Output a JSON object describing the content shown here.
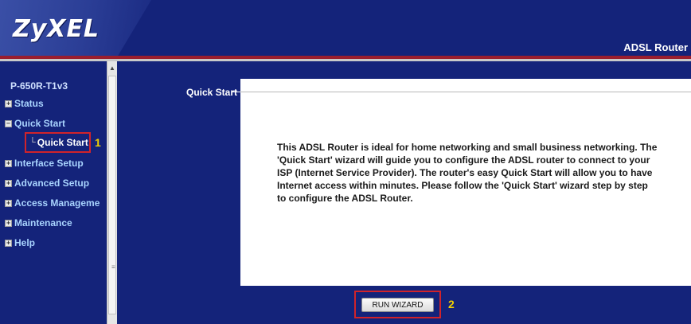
{
  "header": {
    "logo": "ZyXEL",
    "product": "ADSL Router"
  },
  "sidebar": {
    "device": "P-650R-T1v3",
    "items": [
      {
        "label": "Status",
        "expanded": false
      },
      {
        "label": "Quick Start",
        "expanded": true
      },
      {
        "label": "Interface Setup",
        "expanded": false
      },
      {
        "label": "Advanced Setup",
        "expanded": false
      },
      {
        "label": "Access Manageme",
        "expanded": false
      },
      {
        "label": "Maintenance",
        "expanded": false
      },
      {
        "label": "Help",
        "expanded": false
      }
    ],
    "sub_item": "Quick Start",
    "marker_1": "1",
    "expand_symbol": "+",
    "collapse_symbol": "−"
  },
  "main": {
    "section_title": "Quick Start",
    "description": "This ADSL Router is ideal for home networking and small business networking. The 'Quick Start' wizard will guide you to configure the ADSL router to connect to your ISP (Internet Service Provider). The router's easy Quick Start will allow you to have Internet access within minutes. Please follow the 'Quick Start' wizard step by step to configure the ADSL Router.",
    "run_wizard_label": "RUN WIZARD",
    "marker_2": "2"
  },
  "colors": {
    "navy": "#14237a",
    "highlight_red": "#d1232a",
    "marker_yellow": "#f2d100",
    "nav_text": "#a9d4ff"
  }
}
